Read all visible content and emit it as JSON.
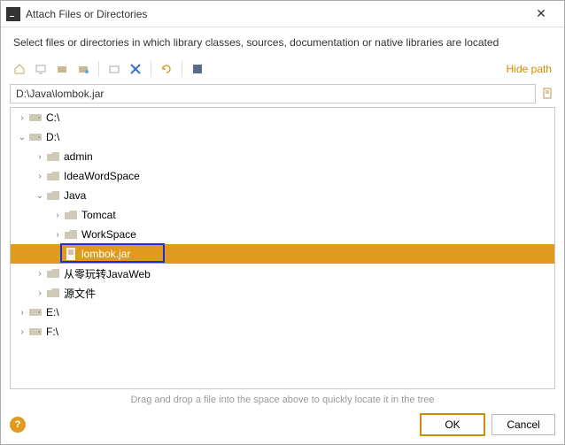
{
  "titlebar": {
    "title": "Attach Files or Directories"
  },
  "subtitle": "Select files or directories in which library classes, sources, documentation or native libraries are located",
  "toolbar": {
    "hide_path": "Hide path"
  },
  "path": {
    "value": "D:\\Java\\lombok.jar"
  },
  "tree": {
    "nodes": [
      {
        "depth": 0,
        "arrow": "right",
        "icon": "drive",
        "label": "C:\\"
      },
      {
        "depth": 0,
        "arrow": "down",
        "icon": "drive",
        "label": "D:\\"
      },
      {
        "depth": 1,
        "arrow": "right",
        "icon": "folder",
        "label": "admin"
      },
      {
        "depth": 1,
        "arrow": "right",
        "icon": "folder",
        "label": "IdeaWordSpace"
      },
      {
        "depth": 1,
        "arrow": "down",
        "icon": "folder",
        "label": "Java"
      },
      {
        "depth": 2,
        "arrow": "right",
        "icon": "folder",
        "label": "Tomcat"
      },
      {
        "depth": 2,
        "arrow": "right",
        "icon": "folder",
        "label": "WorkSpace"
      },
      {
        "depth": 2,
        "arrow": "none",
        "icon": "jar",
        "label": "lombok.jar",
        "selected": true,
        "highlight": true
      },
      {
        "depth": 1,
        "arrow": "right",
        "icon": "folder",
        "label": "从零玩转JavaWeb"
      },
      {
        "depth": 1,
        "arrow": "right",
        "icon": "folder",
        "label": "源文件"
      },
      {
        "depth": 0,
        "arrow": "right",
        "icon": "drive",
        "label": "E:\\"
      },
      {
        "depth": 0,
        "arrow": "right",
        "icon": "drive",
        "label": "F:\\"
      }
    ]
  },
  "hint": "Drag and drop a file into the space above to quickly locate it in the tree",
  "footer": {
    "ok": "OK",
    "cancel": "Cancel"
  }
}
